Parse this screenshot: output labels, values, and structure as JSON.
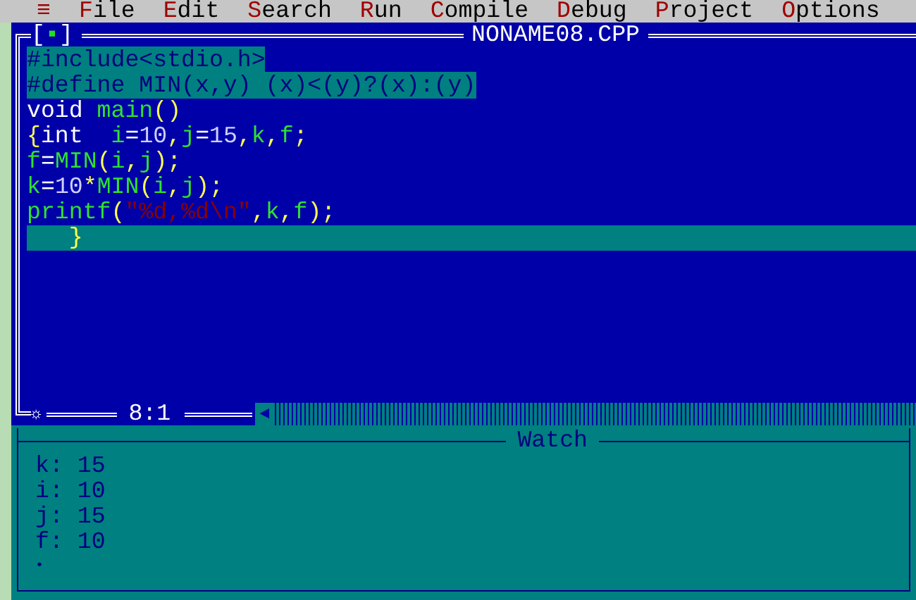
{
  "menu_bar": {
    "system_icon": "≡",
    "items": [
      {
        "hotkey": "F",
        "rest": "ile"
      },
      {
        "hotkey": "E",
        "rest": "dit"
      },
      {
        "hotkey": "S",
        "rest": "earch"
      },
      {
        "hotkey": "R",
        "rest": "un"
      },
      {
        "hotkey": "C",
        "rest": "ompile"
      },
      {
        "hotkey": "D",
        "rest": "ebug"
      },
      {
        "hotkey": "P",
        "rest": "roject"
      },
      {
        "hotkey": "O",
        "rest": "ptions"
      }
    ]
  },
  "editor": {
    "title": "NONAME08.CPP",
    "close_box": "[▪]",
    "lines": [
      {
        "selected": true,
        "current": false,
        "tokens": [
          {
            "kind": "plain",
            "text": "#include<stdio.h>"
          }
        ]
      },
      {
        "selected": true,
        "current": false,
        "tokens": [
          {
            "kind": "plain",
            "text": "#define MIN(x,y) (x)<(y)?(x):(y)"
          }
        ]
      },
      {
        "selected": false,
        "current": false,
        "tokens": [
          {
            "kind": "keyword",
            "text": "void "
          },
          {
            "kind": "identifier",
            "text": "main"
          },
          {
            "kind": "symbol",
            "text": "()"
          }
        ]
      },
      {
        "selected": false,
        "current": false,
        "tokens": [
          {
            "kind": "symbol",
            "text": "{"
          },
          {
            "kind": "keyword",
            "text": "int  "
          },
          {
            "kind": "identifier",
            "text": "i"
          },
          {
            "kind": "keyword",
            "text": "="
          },
          {
            "kind": "number",
            "text": "10"
          },
          {
            "kind": "symbol",
            "text": ","
          },
          {
            "kind": "identifier",
            "text": "j"
          },
          {
            "kind": "keyword",
            "text": "="
          },
          {
            "kind": "number",
            "text": "15"
          },
          {
            "kind": "symbol",
            "text": ","
          },
          {
            "kind": "identifier",
            "text": "k"
          },
          {
            "kind": "symbol",
            "text": ","
          },
          {
            "kind": "identifier",
            "text": "f"
          },
          {
            "kind": "symbol",
            "text": ";"
          }
        ]
      },
      {
        "selected": false,
        "current": false,
        "tokens": [
          {
            "kind": "identifier",
            "text": "f"
          },
          {
            "kind": "keyword",
            "text": "="
          },
          {
            "kind": "identifier",
            "text": "MIN"
          },
          {
            "kind": "symbol",
            "text": "("
          },
          {
            "kind": "identifier",
            "text": "i"
          },
          {
            "kind": "symbol",
            "text": ","
          },
          {
            "kind": "identifier",
            "text": "j"
          },
          {
            "kind": "symbol",
            "text": ");"
          }
        ]
      },
      {
        "selected": false,
        "current": false,
        "tokens": [
          {
            "kind": "identifier",
            "text": "k"
          },
          {
            "kind": "keyword",
            "text": "="
          },
          {
            "kind": "number",
            "text": "10"
          },
          {
            "kind": "symbol",
            "text": "*"
          },
          {
            "kind": "identifier",
            "text": "MIN"
          },
          {
            "kind": "symbol",
            "text": "("
          },
          {
            "kind": "identifier",
            "text": "i"
          },
          {
            "kind": "symbol",
            "text": ","
          },
          {
            "kind": "identifier",
            "text": "j"
          },
          {
            "kind": "symbol",
            "text": ");"
          }
        ]
      },
      {
        "selected": false,
        "current": false,
        "tokens": [
          {
            "kind": "identifier",
            "text": "printf"
          },
          {
            "kind": "symbol",
            "text": "("
          },
          {
            "kind": "string",
            "text": "\"%d,%d\\n\""
          },
          {
            "kind": "symbol",
            "text": ","
          },
          {
            "kind": "identifier",
            "text": "k"
          },
          {
            "kind": "symbol",
            "text": ","
          },
          {
            "kind": "identifier",
            "text": "f"
          },
          {
            "kind": "symbol",
            "text": ");"
          }
        ]
      },
      {
        "selected": false,
        "current": true,
        "tokens": [
          {
            "kind": "symbol",
            "text": "   }"
          }
        ]
      }
    ],
    "status": {
      "corner_icon": "☼",
      "position": "8:1",
      "scroll_arrow": "◄"
    }
  },
  "watch": {
    "title": "Watch",
    "entries": [
      "k: 15",
      "i: 10",
      "j: 15",
      "f: 10"
    ],
    "marker": "•"
  }
}
